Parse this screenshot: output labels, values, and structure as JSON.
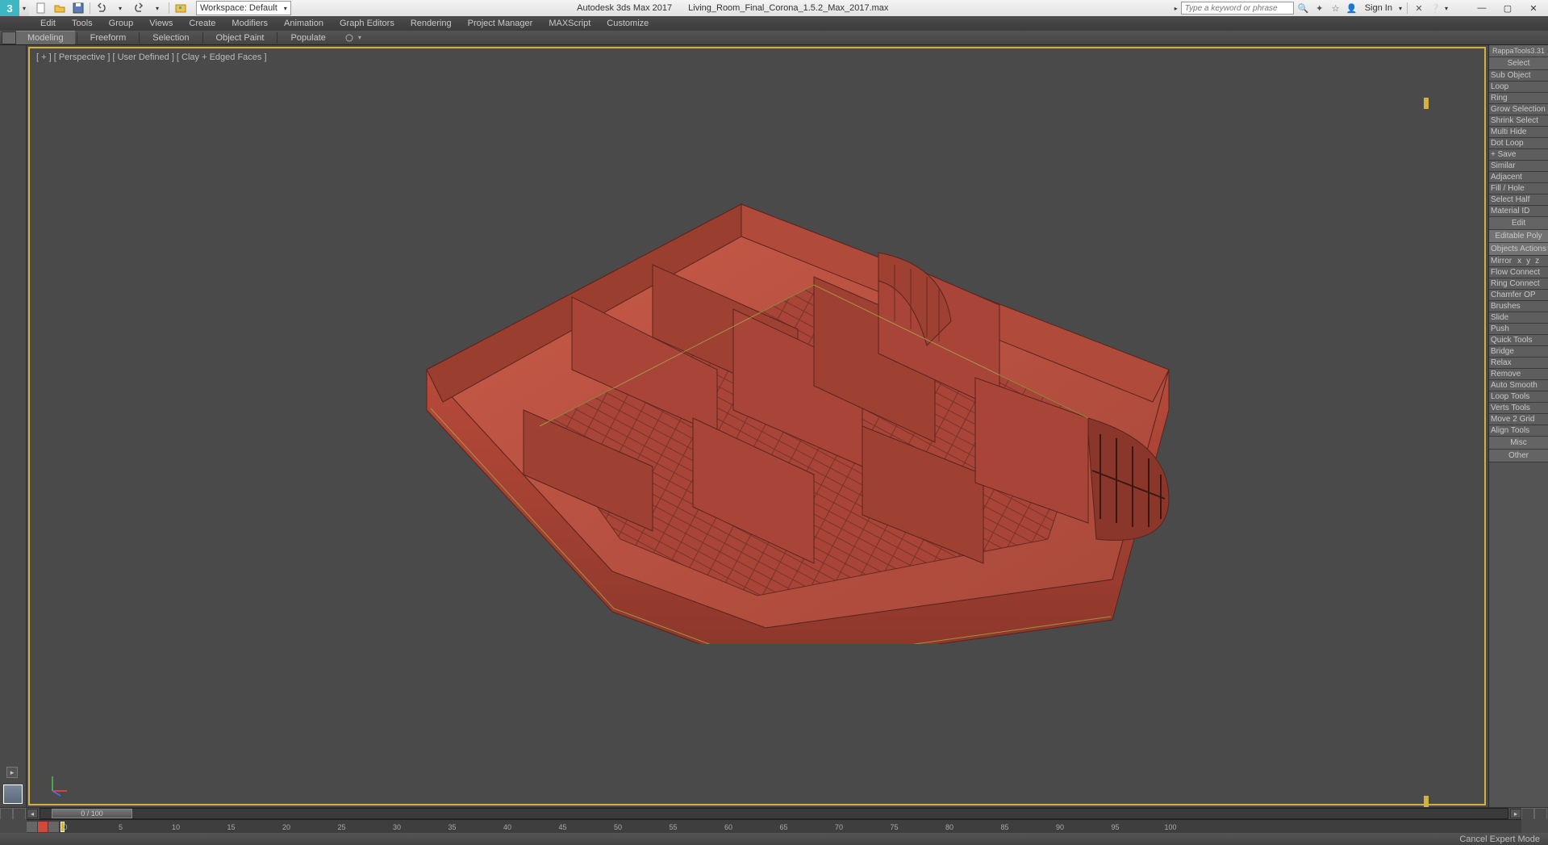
{
  "title": {
    "app": "Autodesk 3ds Max 2017",
    "file": "Living_Room_Final_Corona_1.5.2_Max_2017.max"
  },
  "workspace": {
    "label": "Workspace: Default"
  },
  "search": {
    "placeholder": "Type a keyword or phrase"
  },
  "signin": {
    "label": "Sign In"
  },
  "menu": [
    "Edit",
    "Tools",
    "Group",
    "Views",
    "Create",
    "Modifiers",
    "Animation",
    "Graph Editors",
    "Rendering",
    "Project Manager",
    "MAXScript",
    "Customize"
  ],
  "ribbon": [
    "Modeling",
    "Freeform",
    "Selection",
    "Object Paint",
    "Populate"
  ],
  "viewport_label": "[ + ] [ Perspective ] [ User Defined ] [ Clay + Edged Faces ]",
  "rappa": {
    "title": "RappaTools3.31",
    "items": [
      {
        "t": "Select",
        "c": "ctr"
      },
      {
        "t": "Sub Object"
      },
      {
        "t": "Loop"
      },
      {
        "t": "Ring"
      },
      {
        "t": "Grow Selection"
      },
      {
        "t": "Shrink Select"
      },
      {
        "t": "Multi Hide"
      },
      {
        "t": "Dot Loop"
      },
      {
        "t": "+ Save"
      },
      {
        "t": "Similar"
      },
      {
        "t": "Adjacent"
      },
      {
        "t": "Fill / Hole"
      },
      {
        "t": "Select Half"
      },
      {
        "t": "Material ID"
      },
      {
        "t": "Edit",
        "c": "ctr"
      },
      {
        "t": "Editable Poly",
        "hl": 1
      },
      {
        "t": "Objects Actions",
        "hl": 1
      },
      {
        "t": "Mirror  x  y  z",
        "m": 1
      },
      {
        "t": "Flow Connect"
      },
      {
        "t": "Ring Connect"
      },
      {
        "t": "Chamfer OP"
      },
      {
        "t": "Brushes"
      },
      {
        "t": "Slide"
      },
      {
        "t": "Push"
      },
      {
        "t": "Quick Tools"
      },
      {
        "t": "Bridge"
      },
      {
        "t": "Relax"
      },
      {
        "t": "Remove"
      },
      {
        "t": "Auto Smooth"
      },
      {
        "t": "Loop Tools"
      },
      {
        "t": "Verts Tools"
      },
      {
        "t": "Move 2 Grid"
      },
      {
        "t": "Align Tools"
      },
      {
        "t": "Misc",
        "c": "ctr"
      },
      {
        "t": "Other",
        "c": "ctr"
      }
    ]
  },
  "timeslider": {
    "value": "0 / 100"
  },
  "timeline": {
    "start": 0,
    "end": 100,
    "step": 5
  },
  "status": {
    "right": "Cancel Expert Mode"
  }
}
